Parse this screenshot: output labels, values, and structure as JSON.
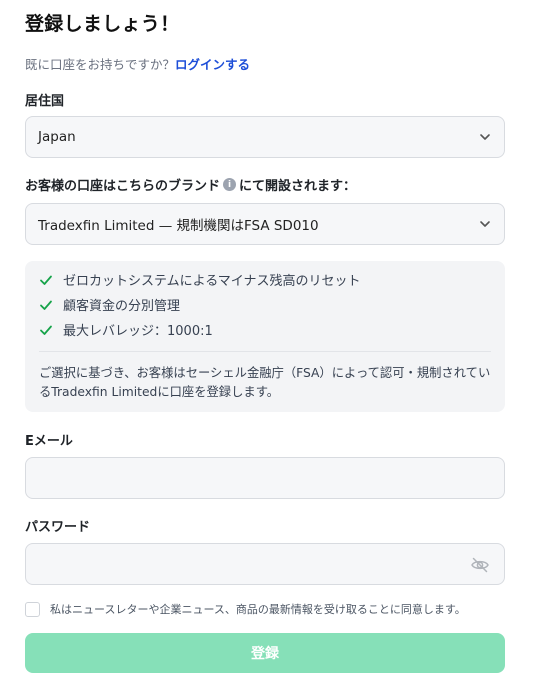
{
  "header": {
    "title": "登録しましょう！",
    "login_prompt": "既に口座をお持ちですか？",
    "login_link": "ログインする"
  },
  "form": {
    "country": {
      "label": "居住国",
      "value": "Japan"
    },
    "brand": {
      "label_before": "お客様の口座はこちらのブランド",
      "label_after": "にて開設されます：",
      "value": "Tradexfin Limited — 規制機関はFSA SD010"
    },
    "features": [
      "ゼロカットシステムによるマイナス残高のリセット",
      "顧客資金の分別管理",
      "最大レバレッジ：1000:1"
    ],
    "disclaimer": "ご選択に基づき、お客様はセーシェル金融庁（FSA）によって認可・規制されているTradexfin Limitedに口座を登録します。",
    "email": {
      "label": "Eメール",
      "value": ""
    },
    "password": {
      "label": "パスワード",
      "value": ""
    },
    "consent_text": "私はニュースレターや企業ニュース、商品の最新情報を受け取ることに同意します。",
    "submit_label": "登録"
  },
  "colors": {
    "link": "#1d4ed8",
    "check": "#16a34a",
    "submit_disabled": "#86e0b8"
  },
  "icons": {
    "brand_info": "info-icon",
    "feature": "check-icon",
    "select": "chevron-down-icon",
    "password_toggle": "eye-off-icon"
  }
}
